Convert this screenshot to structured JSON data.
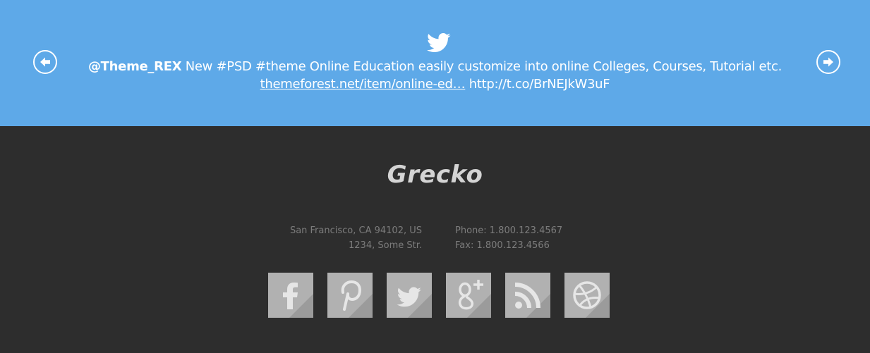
{
  "tweet": {
    "handle": "@Theme_REX",
    "text": " New #PSD #theme Online Education easily customize into online Colleges, Courses, Tutorial etc.",
    "link_text": "themeforest.net/item/online-ed…",
    "short_url": " http://t.co/BrNEJkW3uF",
    "icon": "twitter-bird-icon",
    "prev_icon": "arrow-left-icon",
    "next_icon": "arrow-right-icon"
  },
  "footer": {
    "logo": "Grecko",
    "address_line1": "San Francisco, CA 94102, US",
    "address_line2": "1234, Some Str.",
    "phone": "Phone: 1.800.123.4567",
    "fax": "Fax: 1.800.123.4566"
  },
  "socials": [
    {
      "name": "facebook",
      "icon": "facebook-icon"
    },
    {
      "name": "pinterest",
      "icon": "pinterest-icon"
    },
    {
      "name": "twitter",
      "icon": "twitter-icon"
    },
    {
      "name": "google-plus",
      "icon": "google-plus-icon"
    },
    {
      "name": "rss",
      "icon": "rss-icon"
    },
    {
      "name": "dribbble",
      "icon": "dribbble-icon"
    }
  ],
  "colors": {
    "band": "#5ea9e8",
    "footer": "#2d2d2d",
    "social_tile": "#b1b1b1"
  }
}
